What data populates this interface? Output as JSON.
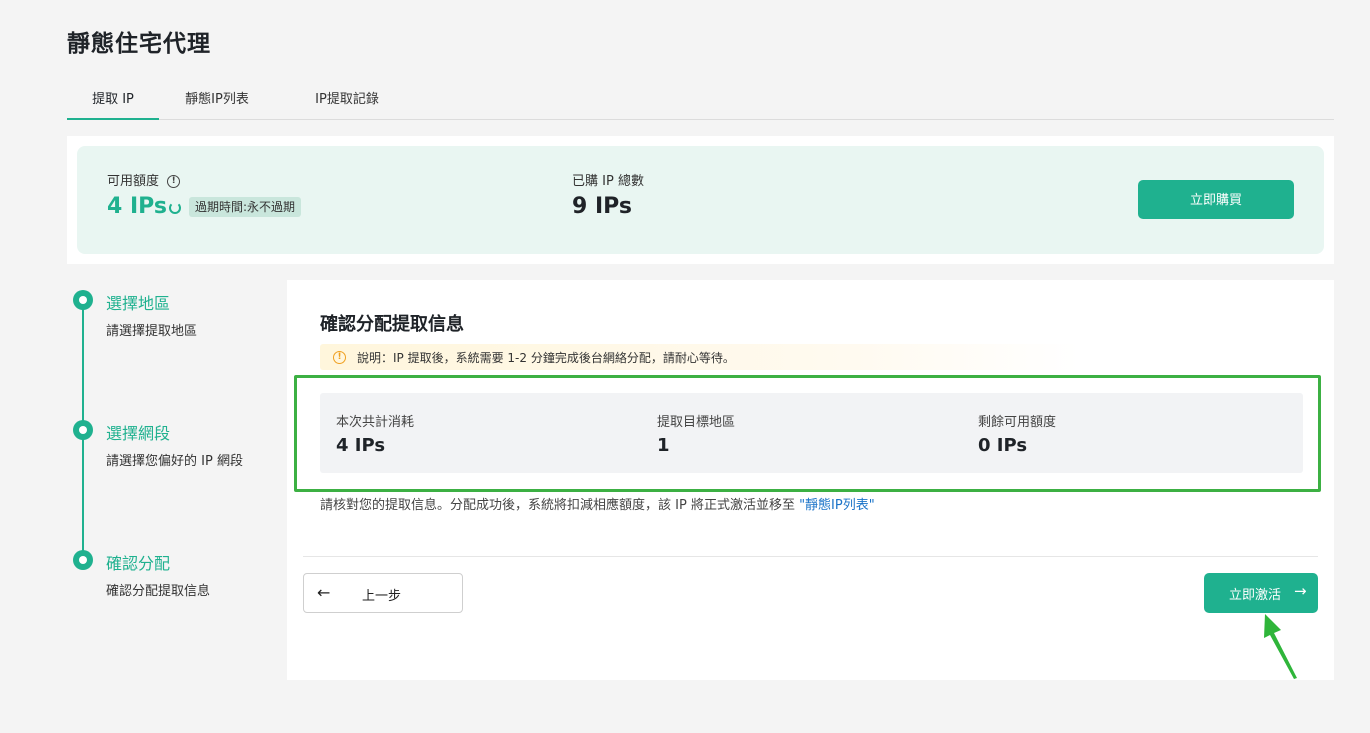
{
  "page": {
    "title": "靜態住宅代理"
  },
  "tabs": [
    {
      "label": "提取 IP",
      "active": true
    },
    {
      "label": "靜態IP列表",
      "active": false
    },
    {
      "label": "IP提取記錄",
      "active": false
    }
  ],
  "summary": {
    "available_label": "可用額度",
    "available_value": "4 IPs",
    "expire_text": "過期時間:永不過期",
    "purchased_label": "已購 IP 總數",
    "purchased_value": "9 IPs",
    "buy_button": "立即購買"
  },
  "steps": [
    {
      "title": "選擇地區",
      "desc": "請選擇提取地區"
    },
    {
      "title": "選擇網段",
      "desc": "請選擇您偏好的 IP 網段"
    },
    {
      "title": "確認分配",
      "desc": "確認分配提取信息"
    }
  ],
  "panel": {
    "title": "確認分配提取信息",
    "notice": "說明：IP 提取後，系統需要 1-2 分鐘完成後台網絡分配，請耐心等待。",
    "stats": [
      {
        "label": "本次共計消耗",
        "value": "4 IPs"
      },
      {
        "label": "提取目標地區",
        "value": "1"
      },
      {
        "label": "剩餘可用額度",
        "value": "0 IPs"
      }
    ],
    "confirm_text": "請核對您的提取信息。分配成功後，系統將扣減相應額度，該 IP 將正式激活並移至 ",
    "confirm_link": "\"靜態IP列表\"",
    "back_button": "上一步",
    "activate_button": "立即激活"
  },
  "colors": {
    "accent": "#1fb18f",
    "highlight": "#3cb043",
    "link": "#1a73c8"
  },
  "icons": {
    "info": "info-icon",
    "refresh": "refresh-icon",
    "warning": "warning-icon",
    "back": "arrow-left-icon",
    "forward": "arrow-right-icon"
  }
}
